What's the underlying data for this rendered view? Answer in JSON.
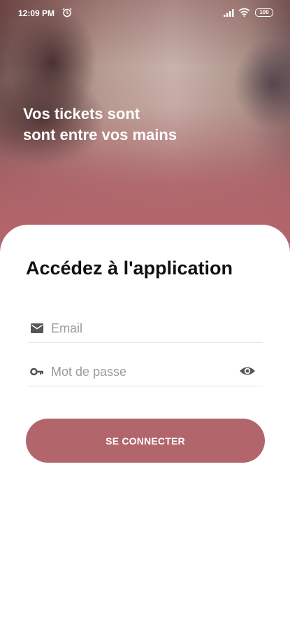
{
  "status_bar": {
    "time": "12:09 PM",
    "battery": "100",
    "icons": [
      "alarm-icon",
      "signal-icon",
      "wifi-icon",
      "battery-icon"
    ]
  },
  "hero": {
    "line1": "Vos tickets sont",
    "line2": "sont entre vos mains"
  },
  "login": {
    "title": "Accédez à l'application",
    "email_placeholder": "Email",
    "email_icon": "mail-icon",
    "password_placeholder": "Mot de passe",
    "password_icon": "key-icon",
    "toggle_icon": "eye-icon",
    "submit_label": "SE CONNECTER"
  },
  "colors": {
    "accent": "#b2656b",
    "title_text": "#111111",
    "placeholder": "#9a9a9a",
    "icon": "#555555"
  }
}
